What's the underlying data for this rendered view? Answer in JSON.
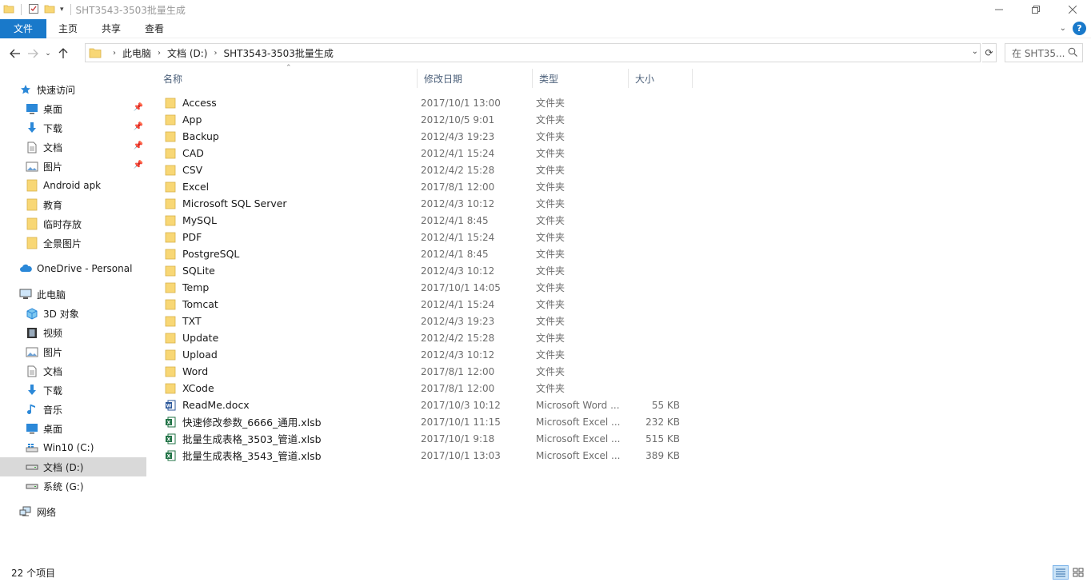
{
  "window": {
    "title": "SHT3543-3503批量生成",
    "controls": [
      "minimize",
      "maximize",
      "close"
    ]
  },
  "ribbon": {
    "tabs": [
      {
        "label": "文件",
        "active": true
      },
      {
        "label": "主页"
      },
      {
        "label": "共享"
      },
      {
        "label": "查看"
      }
    ],
    "help": "?"
  },
  "address": {
    "breadcrumbs": [
      "此电脑",
      "文档 (D:)",
      "SHT3543-3503批量生成"
    ],
    "search_placeholder": "在 SHT35..."
  },
  "nav": {
    "items": [
      {
        "label": "快速访问",
        "icon": "star-icon",
        "level": 0
      },
      {
        "label": "桌面",
        "icon": "desktop-icon",
        "level": 1,
        "pinned": true
      },
      {
        "label": "下载",
        "icon": "download-icon",
        "level": 1,
        "pinned": true
      },
      {
        "label": "文档",
        "icon": "document-icon",
        "level": 1,
        "pinned": true
      },
      {
        "label": "图片",
        "icon": "picture-icon",
        "level": 1,
        "pinned": true
      },
      {
        "label": "Android apk",
        "icon": "folder-icon",
        "level": 1
      },
      {
        "label": "教育",
        "icon": "folder-icon",
        "level": 1
      },
      {
        "label": "临时存放",
        "icon": "folder-icon",
        "level": 1
      },
      {
        "label": "全景图片",
        "icon": "folder-icon",
        "level": 1
      },
      {
        "label": "OneDrive - Personal",
        "icon": "cloud-icon",
        "level": 0
      },
      {
        "label": "此电脑",
        "icon": "computer-icon",
        "level": 0
      },
      {
        "label": "3D 对象",
        "icon": "cube-icon",
        "level": 1
      },
      {
        "label": "视频",
        "icon": "video-icon",
        "level": 1
      },
      {
        "label": "图片",
        "icon": "picture-icon",
        "level": 1
      },
      {
        "label": "文档",
        "icon": "document-icon",
        "level": 1
      },
      {
        "label": "下载",
        "icon": "download-icon",
        "level": 1
      },
      {
        "label": "音乐",
        "icon": "music-icon",
        "level": 1
      },
      {
        "label": "桌面",
        "icon": "desktop-icon",
        "level": 1
      },
      {
        "label": "Win10 (C:)",
        "icon": "drive-windows-icon",
        "level": 1
      },
      {
        "label": "文档 (D:)",
        "icon": "drive-icon",
        "level": 1,
        "selected": true
      },
      {
        "label": "系统 (G:)",
        "icon": "drive-icon",
        "level": 1
      },
      {
        "label": "网络",
        "icon": "network-icon",
        "level": 0
      }
    ]
  },
  "columns": {
    "name": "名称",
    "date": "修改日期",
    "type": "类型",
    "size": "大小"
  },
  "files": [
    {
      "name": "Access",
      "date": "2017/10/1 13:00",
      "type": "文件夹",
      "size": "",
      "icon": "folder-icon"
    },
    {
      "name": "App",
      "date": "2012/10/5 9:01",
      "type": "文件夹",
      "size": "",
      "icon": "folder-icon"
    },
    {
      "name": "Backup",
      "date": "2012/4/3 19:23",
      "type": "文件夹",
      "size": "",
      "icon": "folder-icon"
    },
    {
      "name": "CAD",
      "date": "2012/4/1 15:24",
      "type": "文件夹",
      "size": "",
      "icon": "folder-icon"
    },
    {
      "name": "CSV",
      "date": "2012/4/2 15:28",
      "type": "文件夹",
      "size": "",
      "icon": "folder-icon"
    },
    {
      "name": "Excel",
      "date": "2017/8/1 12:00",
      "type": "文件夹",
      "size": "",
      "icon": "folder-icon"
    },
    {
      "name": "Microsoft SQL Server",
      "date": "2012/4/3 10:12",
      "type": "文件夹",
      "size": "",
      "icon": "folder-icon"
    },
    {
      "name": "MySQL",
      "date": "2012/4/1 8:45",
      "type": "文件夹",
      "size": "",
      "icon": "folder-icon"
    },
    {
      "name": "PDF",
      "date": "2012/4/1 15:24",
      "type": "文件夹",
      "size": "",
      "icon": "folder-icon"
    },
    {
      "name": "PostgreSQL",
      "date": "2012/4/1 8:45",
      "type": "文件夹",
      "size": "",
      "icon": "folder-icon"
    },
    {
      "name": "SQLite",
      "date": "2012/4/3 10:12",
      "type": "文件夹",
      "size": "",
      "icon": "folder-icon"
    },
    {
      "name": "Temp",
      "date": "2017/10/1 14:05",
      "type": "文件夹",
      "size": "",
      "icon": "folder-icon"
    },
    {
      "name": "Tomcat",
      "date": "2012/4/1 15:24",
      "type": "文件夹",
      "size": "",
      "icon": "folder-icon"
    },
    {
      "name": "TXT",
      "date": "2012/4/3 19:23",
      "type": "文件夹",
      "size": "",
      "icon": "folder-icon"
    },
    {
      "name": "Update",
      "date": "2012/4/2 15:28",
      "type": "文件夹",
      "size": "",
      "icon": "folder-icon"
    },
    {
      "name": "Upload",
      "date": "2012/4/3 10:12",
      "type": "文件夹",
      "size": "",
      "icon": "folder-icon"
    },
    {
      "name": "Word",
      "date": "2017/8/1 12:00",
      "type": "文件夹",
      "size": "",
      "icon": "folder-icon"
    },
    {
      "name": "XCode",
      "date": "2017/8/1 12:00",
      "type": "文件夹",
      "size": "",
      "icon": "folder-icon"
    },
    {
      "name": "ReadMe.docx",
      "date": "2017/10/3 10:12",
      "type": "Microsoft Word ...",
      "size": "55 KB",
      "icon": "word-file-icon"
    },
    {
      "name": "快速修改参数_6666_通用.xlsb",
      "date": "2017/10/1 11:15",
      "type": "Microsoft Excel ...",
      "size": "232 KB",
      "icon": "excel-file-icon"
    },
    {
      "name": "批量生成表格_3503_管道.xlsb",
      "date": "2017/10/1 9:18",
      "type": "Microsoft Excel ...",
      "size": "515 KB",
      "icon": "excel-file-icon"
    },
    {
      "name": "批量生成表格_3543_管道.xlsb",
      "date": "2017/10/1 13:03",
      "type": "Microsoft Excel ...",
      "size": "389 KB",
      "icon": "excel-file-icon"
    }
  ],
  "status": {
    "item_count": "22 个项目"
  },
  "colors": {
    "accent": "#1979ca",
    "folder": "#f8d775",
    "selected_nav": "#d9d9d9",
    "header_text": "#4c607a"
  }
}
